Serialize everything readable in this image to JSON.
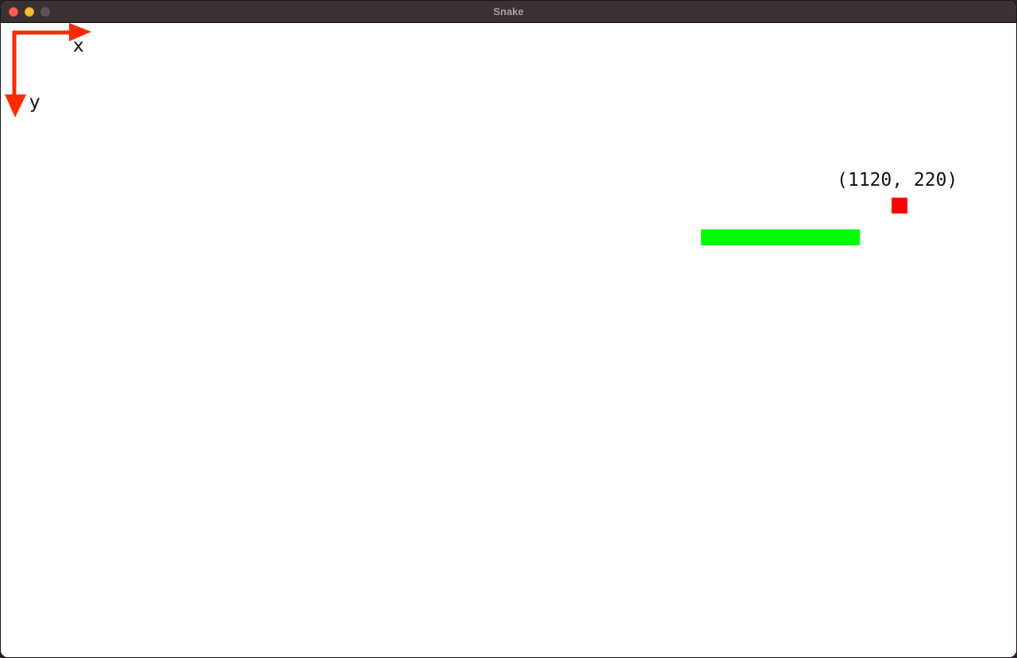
{
  "window": {
    "title": "Snake",
    "traffic_lights": [
      "close",
      "minimize",
      "zoom"
    ]
  },
  "axes": {
    "x_label": "x",
    "y_label": "y",
    "color": "#ff2a00"
  },
  "food": {
    "coordinate_label": "(1120, 220)",
    "color": "#ff0000"
  },
  "snake": {
    "color": "#00ff00"
  }
}
